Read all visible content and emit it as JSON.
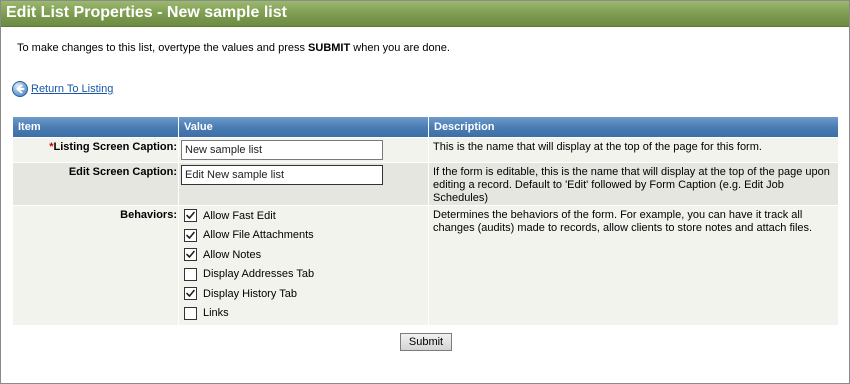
{
  "page": {
    "title": "Edit List Properties - New sample list"
  },
  "intro": {
    "text_before": "To make changes to this list, overtype the values and press ",
    "bold": "SUBMIT",
    "text_after": " when you are done."
  },
  "nav": {
    "back_label": "Return To Listing",
    "back_icon": "back-arrow-icon"
  },
  "table": {
    "headers": [
      "Item",
      "Value",
      "Description"
    ],
    "rows": [
      {
        "required_mark": "*",
        "label": "Listing Screen Caption:",
        "value": "New sample list",
        "description": "This is the name that will display at the top of the page for this form."
      },
      {
        "required_mark": "",
        "label": "Edit Screen Caption:",
        "value": "Edit New sample list",
        "description": "If the form is editable, this is the name that will display at the top of the page upon editing a record.  Default to 'Edit' followed by Form Caption (e.g. Edit Job Schedules)"
      },
      {
        "required_mark": "",
        "label": "Behaviors:",
        "description": "Determines the behaviors of the form.  For example, you can have it track all changes (audits) made to records, allow clients to store notes and attach files.",
        "options": [
          {
            "label": "Allow Fast Edit",
            "checked": true
          },
          {
            "label": "Allow File Attachments",
            "checked": true
          },
          {
            "label": "Allow Notes",
            "checked": true
          },
          {
            "label": "Display Addresses Tab",
            "checked": false
          },
          {
            "label": "Display History Tab",
            "checked": true
          },
          {
            "label": "Links",
            "checked": false
          }
        ]
      }
    ]
  },
  "actions": {
    "submit_label": "Submit"
  },
  "colors": {
    "titlebar": "#7c9b4f",
    "header": "#4b7db5",
    "required": "#cc0000",
    "link": "#1a56a8"
  }
}
